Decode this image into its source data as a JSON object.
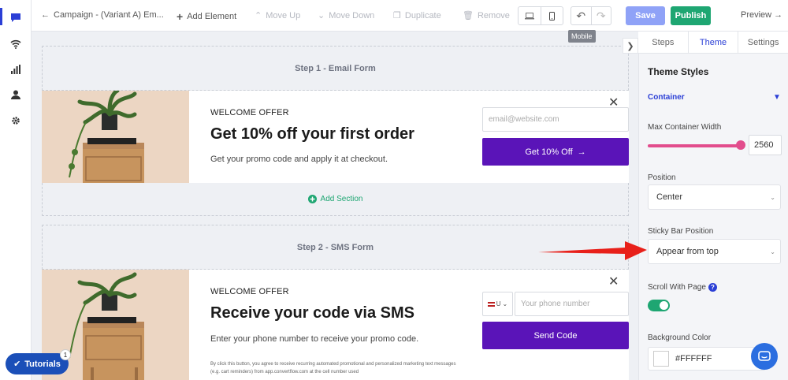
{
  "toolbar": {
    "campaign_title": "Campaign - (Variant A) Em...",
    "add_element": "Add Element",
    "move_up": "Move Up",
    "move_down": "Move Down",
    "duplicate": "Duplicate",
    "remove": "Remove",
    "tooltip": "Mobile",
    "save": "Save",
    "publish": "Publish",
    "preview": "Preview →"
  },
  "steps": [
    {
      "header": "Step 1 - Email Form",
      "offer_label": "WELCOME OFFER",
      "title": "Get 10% off your first order",
      "subtitle": "Get your promo code and apply it at checkout.",
      "input_placeholder": "email@website.com",
      "button": "Get 10% Off",
      "button_arrow": "→"
    },
    {
      "header": "Step 2 - SMS Form",
      "offer_label": "WELCOME OFFER",
      "title": "Receive your code via SMS",
      "subtitle": "Enter your phone number to receive your promo code.",
      "country": "U",
      "input_placeholder": "Your phone number",
      "button": "Send Code",
      "disclaimer": "By click this button, you agree to receive recurring automated promotional and personalized marketing text messages (e.g. cart reminders) from app.convertflow.com at the cell number used"
    }
  ],
  "add_section": "Add Section",
  "panel": {
    "tabs": [
      "Steps",
      "Theme",
      "Settings"
    ],
    "active_tab": "Theme",
    "heading": "Theme Styles",
    "section": "Container",
    "max_width_label": "Max Container Width",
    "max_width_value": "2560",
    "max_width_fraction": 1.0,
    "position_label": "Position",
    "position_value": "Center",
    "sticky_label": "Sticky Bar Position",
    "sticky_value": "Appear from top",
    "scroll_label": "Scroll With Page",
    "scroll_on": true,
    "bg_label": "Background Color",
    "bg_value": "#FFFFFF"
  },
  "tutorials": {
    "label": "Tutorials",
    "badge": "1"
  },
  "colors": {
    "accent_blue": "#2b3fd6",
    "purple_button": "#5a14b8",
    "publish_green": "#1ea672",
    "slider_pink": "#e24d8d",
    "annotation_red": "#e8201a"
  }
}
